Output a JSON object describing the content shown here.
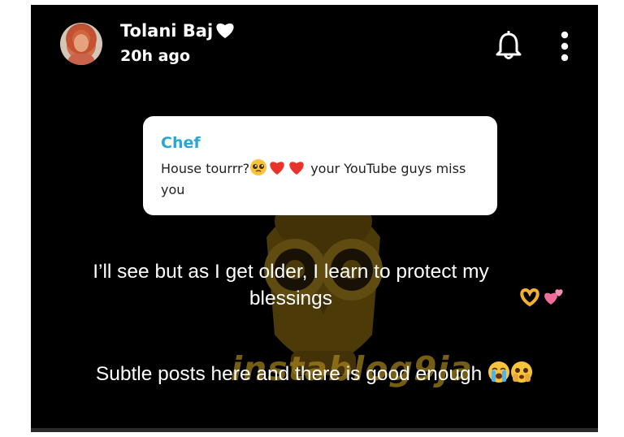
{
  "header": {
    "username": "Tolani Baj",
    "username_icon": "white-heart-icon",
    "timestamp": "20h ago",
    "notification_icon": "bell-icon",
    "menu_icon": "more-vertical-icon"
  },
  "reply_card": {
    "name": "Chef",
    "message_part1": "House tourrr?",
    "message_emojis": [
      "pleading-face",
      "heart",
      "heart"
    ],
    "message_part2": "your YouTube guys miss you"
  },
  "captions": {
    "line1_text": "I’ll see but as I get older, I learn to protect my blessings",
    "line1_emojis": [
      "heart-hands",
      "two-hearts"
    ],
    "line2_text": "Subtle posts here and there is good enough",
    "line2_emojis": [
      "loudly-crying-face",
      "face-holding-back-tears"
    ]
  },
  "watermark": {
    "text": "instablog9ja"
  },
  "colors": {
    "background": "#000000",
    "accent_name": "#29a6d6",
    "card": "#ffffff",
    "watermark": "#a8851d"
  }
}
